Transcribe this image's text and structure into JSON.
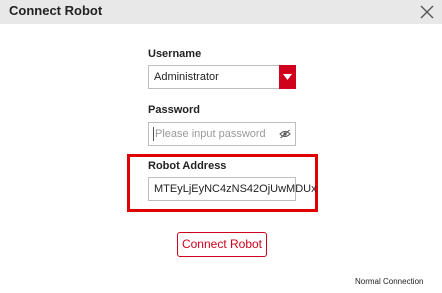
{
  "window": {
    "title": "Connect Robot",
    "close_icon": "close-icon"
  },
  "form": {
    "username": {
      "label": "Username",
      "value": "Administrator"
    },
    "password": {
      "label": "Password",
      "placeholder": "Please input password",
      "value": ""
    },
    "robot_address": {
      "label": "Robot Address",
      "value": "MTEyLjEyNC4zNS42OjUwMDUx"
    }
  },
  "actions": {
    "connect_label": "Connect Robot"
  },
  "status": {
    "connection_mode": "Normal Connection"
  },
  "colors": {
    "accent": "#d0021b",
    "highlight": "#e00000",
    "titlebar": "#e8e8e8"
  }
}
